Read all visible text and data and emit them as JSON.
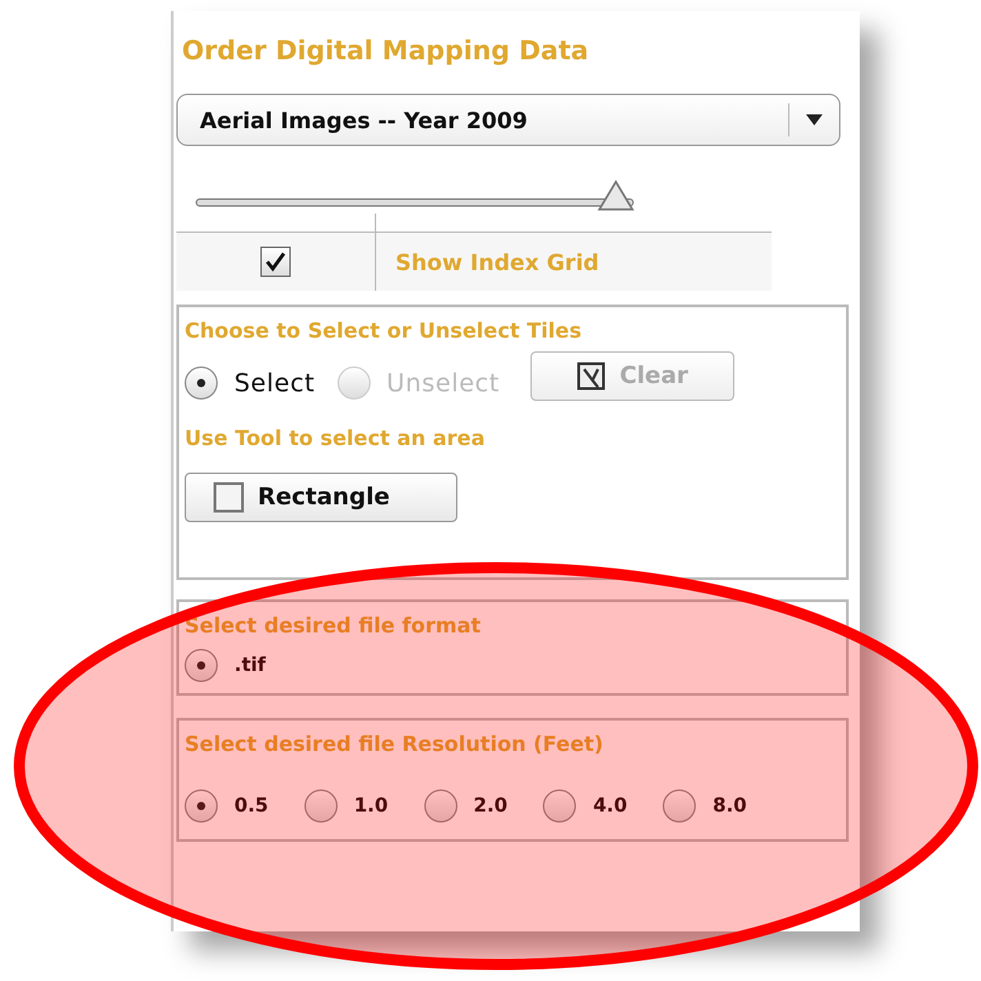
{
  "panel": {
    "title": "Order Digital Mapping Data",
    "dataset_dropdown": {
      "value": "Aerial Images -- Year 2009"
    },
    "slider": {
      "level": 0.96
    },
    "index_grid": {
      "label": "Show Index Grid",
      "checked": true
    },
    "tiles_section": {
      "title": "Choose to Select or Unselect Tiles",
      "options": [
        {
          "label": "Select",
          "selected": true,
          "disabled": false
        },
        {
          "label": "Unselect",
          "selected": false,
          "disabled": true
        }
      ],
      "clear_button": "Clear",
      "tool_title": "Use Tool to select an area",
      "rectangle_button": "Rectangle"
    },
    "format_section": {
      "title": "Select desired file format",
      "options": [
        {
          "label": ".tif",
          "selected": true
        }
      ]
    },
    "resolution_section": {
      "title": "Select desired file Resolution (Feet)",
      "options": [
        {
          "label": "0.5",
          "selected": true
        },
        {
          "label": "1.0",
          "selected": false
        },
        {
          "label": "2.0",
          "selected": false
        },
        {
          "label": "4.0",
          "selected": false
        },
        {
          "label": "8.0",
          "selected": false
        }
      ]
    }
  }
}
